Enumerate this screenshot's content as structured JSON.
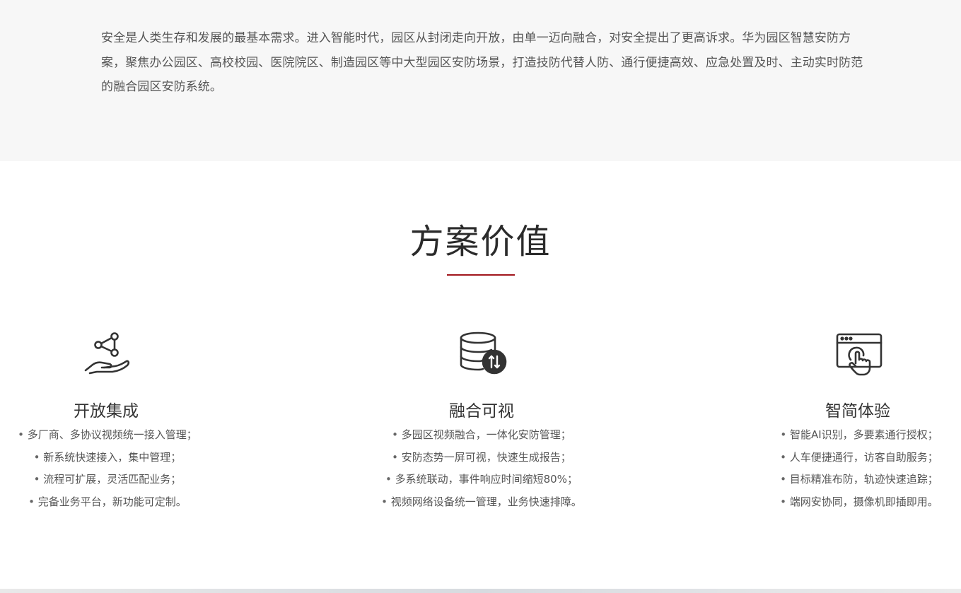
{
  "intro": {
    "text": "安全是人类生存和发展的最基本需求。进入智能时代，园区从封闭走向开放，由单一迈向融合，对安全提出了更高诉求。华为园区智慧安防方案，聚焦办公园区、高校校园、医院院区、制造园区等中大型园区安防场景，打造技防代替人防、通行便捷高效、应急处置及时、主动实时防范的融合园区安防系统。"
  },
  "section": {
    "title": "方案价值"
  },
  "features": [
    {
      "icon": "hand-network-icon",
      "title": "开放集成",
      "items": [
        "多厂商、多协议视频统一接入管理；",
        "新系统快速接入，集中管理；",
        "流程可扩展，灵活匹配业务；",
        "完备业务平台，新功能可定制。"
      ]
    },
    {
      "icon": "database-sync-icon",
      "title": "融合可视",
      "items": [
        "多园区视频融合，一体化安防管理；",
        "安防态势一屏可视，快速生成报告；",
        "多系统联动，事件响应时间缩短80%；",
        "视频网络设备统一管理，业务快速排障。"
      ]
    },
    {
      "icon": "browser-touch-icon",
      "title": "智简体验",
      "items": [
        "智能AI识别，多要素通行授权；",
        "人车便捷通行，访客自助服务；",
        "目标精准布防，轨迹快速追踪；",
        "端网安协同，摄像机即插即用。"
      ]
    }
  ],
  "colors": {
    "accent": "#a1161d",
    "intro_bg": "#f7f7f7",
    "text": "#333333"
  }
}
